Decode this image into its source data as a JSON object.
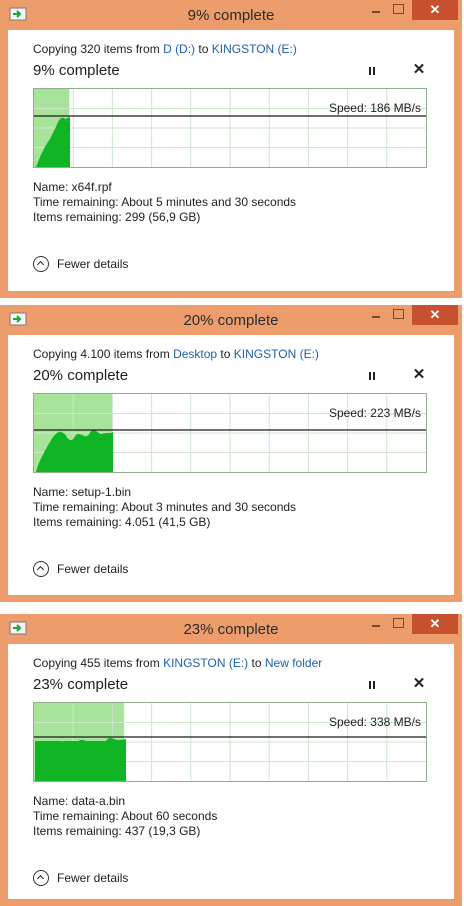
{
  "dialogs": [
    {
      "title": "9% complete",
      "copy_prefix": "Copying 320 items from ",
      "source": "D (D:)",
      "copy_to": " to ",
      "destination": "KINGSTON (E:)",
      "percent_text": "9% complete",
      "progress": 0.09,
      "speed": "Speed: 186 MB/s",
      "name": "Name:  x64f.rpf",
      "time_remaining": "Time remaining:  About 5 minutes and 30 seconds",
      "items_remaining": "Items remaining:  299 (56,9 GB)",
      "fewer_details": "Fewer details",
      "close_glyph": "✕"
    },
    {
      "title": "20% complete",
      "copy_prefix": "Copying 4.100 items from ",
      "source": "Desktop",
      "copy_to": " to ",
      "destination": "KINGSTON (E:)",
      "percent_text": "20% complete",
      "progress": 0.2,
      "speed": "Speed: 223 MB/s",
      "name": "Name:  setup-1.bin",
      "time_remaining": "Time remaining:  About 3 minutes and 30 seconds",
      "items_remaining": "Items remaining:  4.051 (41,5 GB)",
      "fewer_details": "Fewer details",
      "close_glyph": "✕"
    },
    {
      "title": "23% complete",
      "copy_prefix": "Copying 455 items from ",
      "source": "KINGSTON (E:)",
      "copy_to": " to ",
      "destination": "New folder",
      "percent_text": "23% complete",
      "progress": 0.23,
      "speed": "Speed: 338 MB/s",
      "name": "Name:  data-a.bin",
      "time_remaining": "Time remaining:  About 60 seconds",
      "items_remaining": "Items remaining:  437 (19,3 GB)",
      "fewer_details": "Fewer details",
      "close_glyph": "✕"
    }
  ],
  "colors": {
    "frame": "#ed9c6b",
    "graph_fill": "#0fb524",
    "graph_progress": "#a7e49a",
    "link": "#1f5fb0"
  }
}
